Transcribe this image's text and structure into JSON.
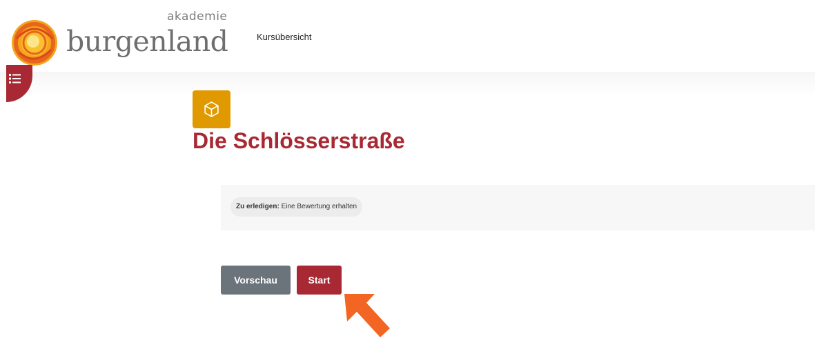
{
  "header": {
    "logo": {
      "small_text": "akademie",
      "big_text": "burgenland"
    },
    "nav_link": "Kursübersicht"
  },
  "drawer": {
    "icon": "list-icon"
  },
  "activity": {
    "icon": "cube-icon",
    "icon_color": "#e09a00",
    "title": "Die Schlösserstraße"
  },
  "completion": {
    "label": "Zu erledigen:",
    "value": "Eine Bewertung erhalten"
  },
  "buttons": {
    "preview_label": "Vorschau",
    "start_label": "Start"
  },
  "colors": {
    "brand": "#a82933",
    "secondary_button": "#6b737b",
    "annotation_arrow": "#f26522"
  }
}
